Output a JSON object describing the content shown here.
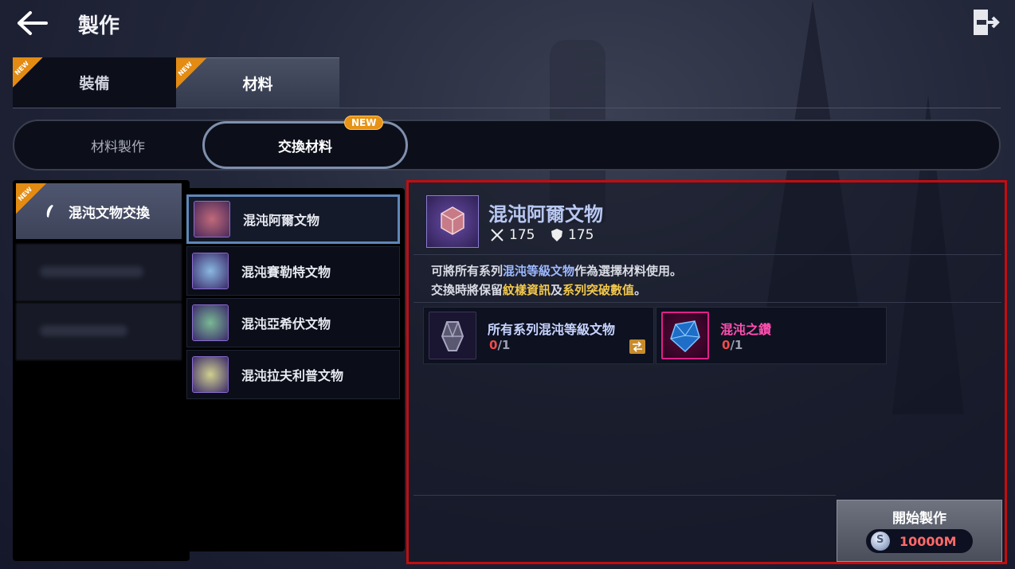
{
  "header": {
    "title": "製作"
  },
  "top_tabs": [
    {
      "label": "裝備",
      "badge": "NEW",
      "active": false
    },
    {
      "label": "材料",
      "badge": "NEW",
      "active": true
    }
  ],
  "sub_tabs": [
    {
      "label": "材料製作",
      "active": false
    },
    {
      "label": "交換材料",
      "active": true,
      "badge": "NEW"
    }
  ],
  "categories": [
    {
      "label": "混沌文物交換",
      "badge": "NEW",
      "selected": true
    }
  ],
  "items": [
    {
      "name": "混沌阿爾文物",
      "color": "#b05a6a",
      "selected": true
    },
    {
      "name": "混沌賽勒特文物",
      "color": "#6a9ac8",
      "selected": false
    },
    {
      "name": "混沌亞希伏文物",
      "color": "#5a9a7a",
      "selected": false
    },
    {
      "name": "混沌拉夫利普文物",
      "color": "#b8b878",
      "selected": false
    }
  ],
  "detail": {
    "name": "混沌阿爾文物",
    "attack": "175",
    "defense": "175",
    "desc_line1": {
      "a": "可將所有系列",
      "b": "混沌等級文物",
      "c": "作為選擇材料使用。"
    },
    "desc_line2": {
      "a": "交換時將保留",
      "b": "紋樣資訊",
      "c": "及",
      "d": "系列突破數值",
      "e": "。"
    },
    "materials": [
      {
        "name": "所有系列混沌等級文物",
        "have": "0",
        "sep": "/",
        "need": "1",
        "name_color": "#c8d4ff"
      },
      {
        "name": "混沌之鑽",
        "have": "0",
        "sep": "/",
        "need": "1",
        "name_color": "#ff4fb0"
      }
    ],
    "craft": {
      "label": "開始製作",
      "cost": "10000M",
      "coin_symbol": "S"
    }
  },
  "colors": {
    "accent_red": "#c20d10",
    "new_orange": "#e38b12",
    "selected_blue": "#5f87b8"
  }
}
